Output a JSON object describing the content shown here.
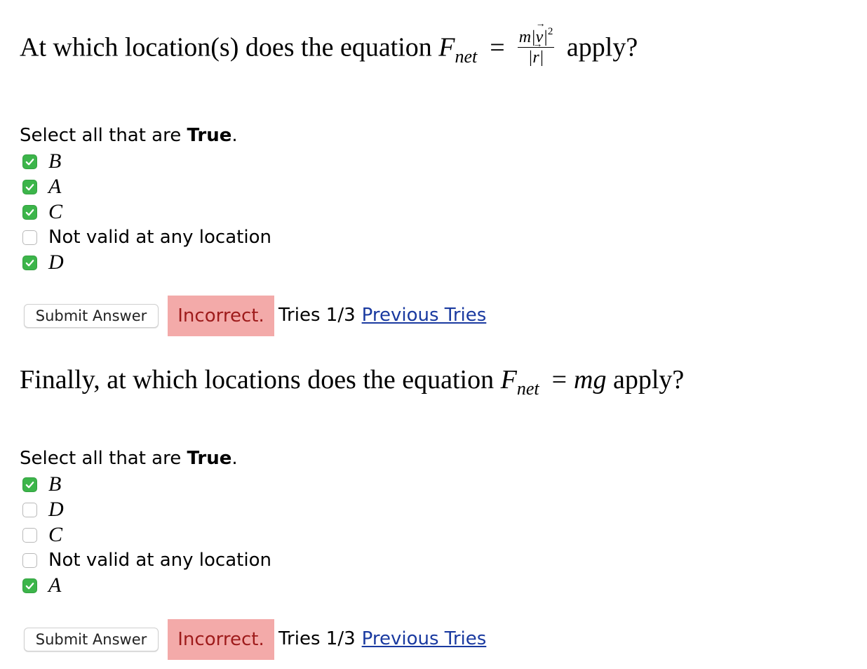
{
  "question1": {
    "prefix": "At which location(s) does the equation ",
    "F": "F",
    "F_sub": "net",
    "equals": "=",
    "frac_num_m": "m|",
    "frac_num_v": "v",
    "frac_num_bar": "|",
    "frac_num_exp": "2",
    "frac_den_open": "|",
    "frac_den_r": "r",
    "frac_den_close": "|",
    "suffix": " apply?",
    "instruction_text": "Select all that are ",
    "instruction_bold": "True",
    "instruction_end": ".",
    "options": [
      {
        "label": "B",
        "checked": true
      },
      {
        "label": "A",
        "checked": true
      },
      {
        "label": "C",
        "checked": true
      },
      {
        "label": "Not valid at any location",
        "checked": false
      },
      {
        "label": "D",
        "checked": true
      }
    ],
    "submit_label": "Submit Answer",
    "status": "Incorrect.",
    "tries": "Tries 1/3",
    "previous_tries": "Previous Tries"
  },
  "question2": {
    "prefix": "Finally, at which locations does the equation ",
    "F": "F",
    "F_sub": "net",
    "equals": "=",
    "rhs": "mg",
    "suffix": " apply?",
    "instruction_text": "Select all that are ",
    "instruction_bold": "True",
    "instruction_end": ".",
    "options": [
      {
        "label": "B",
        "checked": true
      },
      {
        "label": "D",
        "checked": false
      },
      {
        "label": "C",
        "checked": false
      },
      {
        "label": "Not valid at any location",
        "checked": false
      },
      {
        "label": "A",
        "checked": true
      }
    ],
    "submit_label": "Submit Answer",
    "status": "Incorrect.",
    "tries": "Tries 1/3",
    "previous_tries": "Previous Tries"
  },
  "colors": {
    "checkbox_checked": "#3cb54a",
    "status_bg": "#f3aaa9",
    "status_text": "#9e1b1b",
    "link": "#1a3aa0"
  }
}
